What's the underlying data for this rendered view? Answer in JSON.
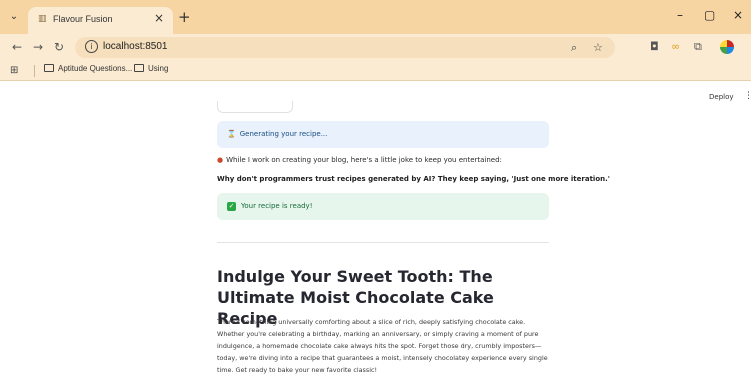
{
  "browser": {
    "tab_title": "Flavour Fusion",
    "tab_close": "×",
    "new_tab": "+",
    "url": "localhost:8501",
    "window_controls": {
      "minimize": "–",
      "restore": "▢",
      "close": "×"
    },
    "bookmarks": [
      "Aptitude Questions...",
      "Using"
    ]
  },
  "app": {
    "deploy_label": "Deploy",
    "menu_glyph": "⋮",
    "status_info": "Generating your recipe...",
    "joke_intro": "While I work on creating your blog, here's a little joke to keep you entertained:",
    "joke": "Why don't programmers trust recipes generated by AI? They keep saying, 'Just one more iteration.'",
    "status_success": "Your recipe is ready!",
    "recipe_title": "Indulge Your Sweet Tooth: The Ultimate Moist Chocolate Cake Recipe",
    "recipe_intro": "There's something universally comforting about a slice of rich, deeply satisfying chocolate cake. Whether you're celebrating a birthday, marking an anniversary, or simply craving a moment of pure indulgence, a homemade chocolate cake always hits the spot. Forget those dry, crumbly imposters—today, we're diving into a recipe that guarantees a moist, intensely chocolatey experience every single time. Get ready to bake your new favorite classic!"
  },
  "colors": {
    "chrome_tabbar": "#f7d5a3",
    "chrome_toolbar": "#fbebd3",
    "info_bg": "#e8f1fc",
    "success_bg": "#e6f6ec",
    "success_icon": "#29a745"
  },
  "icons": [
    "tab-search-icon",
    "favicon-icon",
    "back-icon",
    "forward-icon",
    "reload-icon",
    "info-icon",
    "zoom-icon",
    "star-icon",
    "camera-icon",
    "extension-icon",
    "puzzle-icon",
    "profile-icon",
    "apps-icon",
    "folder-icon",
    "hourglass-icon",
    "cake-icon",
    "checkmark-icon"
  ]
}
